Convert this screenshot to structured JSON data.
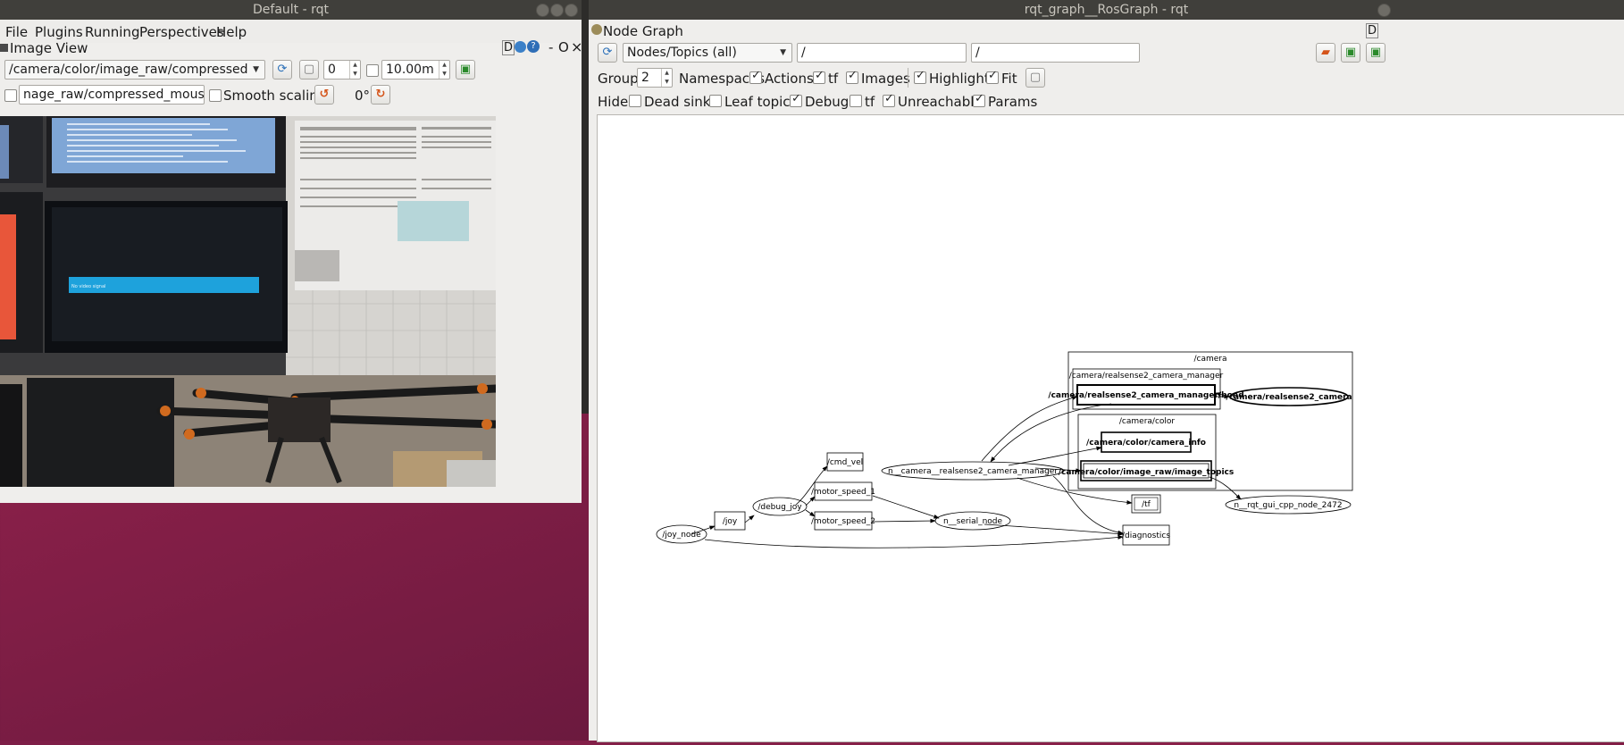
{
  "left_window": {
    "title": "Default - rqt",
    "menu": [
      "File",
      "Plugins",
      "Running",
      "Perspectives",
      "Help"
    ],
    "plugin_title": "Image View",
    "plugin_controls": [
      "D",
      "?",
      "-",
      "O",
      "×"
    ],
    "topic": "/camera/color/image_raw/compressed",
    "spin_value": "0",
    "duration": "10.00m",
    "mouse_topic": "nage_raw/compressed_mouse_left",
    "smooth_scaling_label": "Smooth scaling",
    "rotation": "0°"
  },
  "right_window": {
    "title": "rqt_graph__RosGraph - rqt",
    "plugin_title": "Node Graph",
    "plugin_controls": [
      "D"
    ],
    "mode": "Nodes/Topics (all)",
    "filter1": "/",
    "filter2": "/",
    "group_label": "Group:",
    "group_value": "2",
    "options": [
      {
        "label": "Namespaces",
        "checked": true
      },
      {
        "label": "Actions",
        "checked": true
      },
      {
        "label": "tf",
        "checked": true
      },
      {
        "label": "Images",
        "checked": true
      },
      {
        "label": "Highlight",
        "checked": true
      },
      {
        "label": "Fit",
        "checked": true
      }
    ],
    "hide_label": "Hide:",
    "hide": [
      {
        "label": "Dead sinks",
        "checked": false
      },
      {
        "label": "Leaf topics",
        "checked": false
      },
      {
        "label": "Debug",
        "checked": true
      },
      {
        "label": "tf",
        "checked": false
      },
      {
        "label": "Unreachable",
        "checked": true
      },
      {
        "label": "Params",
        "checked": true
      }
    ]
  },
  "graph": {
    "clusters": {
      "camera": "/camera",
      "manager": "/camera/realsense2_camera_manager",
      "color": "/camera/color"
    },
    "nodes": {
      "bond": "/camera/realsense2_camera_manager/bond",
      "realsense_camera": "/camera/realsense2_camera",
      "camera_info": "/camera/color/camera_info",
      "image_topics": "/camera/color/image_raw/image_topics",
      "camera_manager": "n__camera__realsense2_camera_manager",
      "cmd_vel": "/cmd_vel",
      "motor_speed_1": "/motor_speed_1",
      "motor_speed_2": "/motor_speed_2",
      "debug_joy": "/debug_joy",
      "joy": "/joy",
      "joy_node": "/joy_node",
      "serial_node": "n__serial_node",
      "tf": "/tf",
      "diagnostics": "/diagnostics",
      "rqt_gui": "n__rqt_gui_cpp_node_2472"
    }
  },
  "photo_screen_text": "No video signal"
}
